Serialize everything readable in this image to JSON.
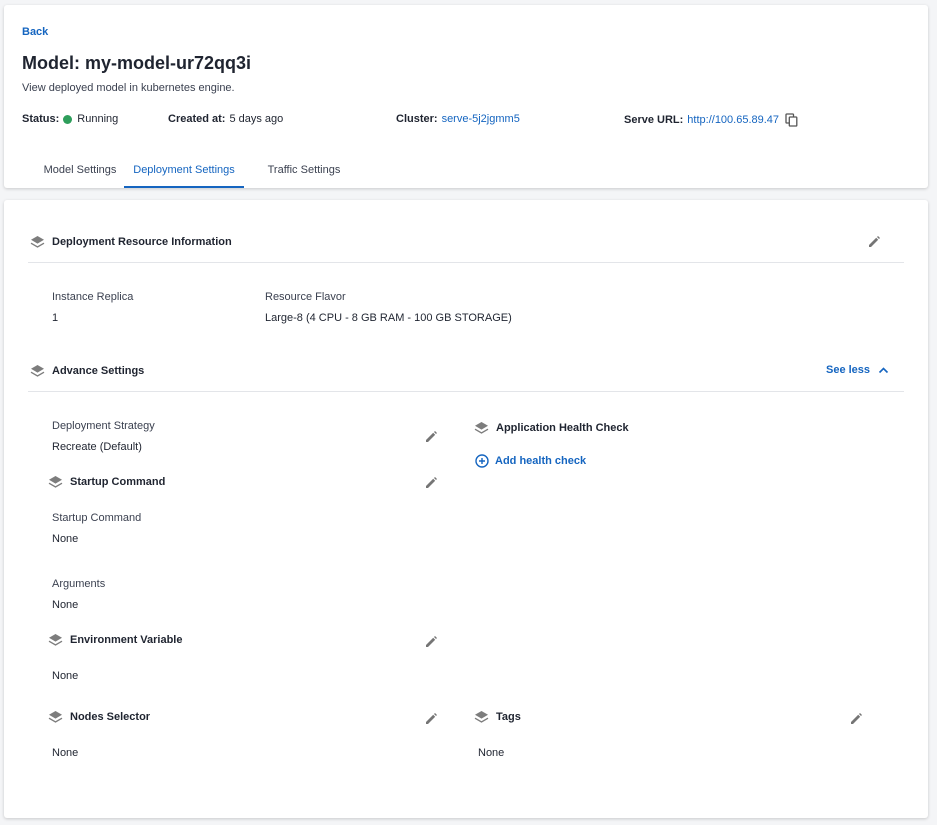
{
  "header": {
    "back_label": "Back",
    "title": "Model: my-model-ur72qq3i",
    "subtitle": "View deployed model in kubernetes engine.",
    "status_label": "Status:",
    "status_value": "Running",
    "status_color": "#2e9e5b",
    "created_label": "Created at:",
    "created_value": "5 days ago",
    "cluster_label": "Cluster:",
    "cluster_value": "serve-5j2jgmm5",
    "serve_url_label": "Serve URL:",
    "serve_url_value": "http://100.65.89.47"
  },
  "tabs": [
    {
      "label": "Model Settings",
      "active": false
    },
    {
      "label": "Deployment Settings",
      "active": true
    },
    {
      "label": "Traffic Settings",
      "active": false
    }
  ],
  "deployment_resource": {
    "title": "Deployment Resource Information",
    "instance_replica_label": "Instance Replica",
    "instance_replica_value": "1",
    "resource_flavor_label": "Resource Flavor",
    "resource_flavor_value": "Large-8 (4 CPU - 8 GB RAM - 100 GB STORAGE)"
  },
  "advance_settings": {
    "title": "Advance Settings",
    "see_less_label": "See less",
    "deployment_strategy_label": "Deployment Strategy",
    "deployment_strategy_value": "Recreate (Default)",
    "startup_command_title": "Startup Command",
    "startup_command_label": "Startup Command",
    "startup_command_value": "None",
    "arguments_label": "Arguments",
    "arguments_value": "None",
    "env_var_title": "Environment Variable",
    "env_var_value": "None",
    "nodes_selector_title": "Nodes Selector",
    "nodes_selector_value": "None",
    "health_check_title": "Application Health Check",
    "add_health_check_label": "Add health check",
    "tags_title": "Tags",
    "tags_value": "None"
  },
  "colors": {
    "accent": "#1565c0",
    "icon_gray": "#757575"
  }
}
